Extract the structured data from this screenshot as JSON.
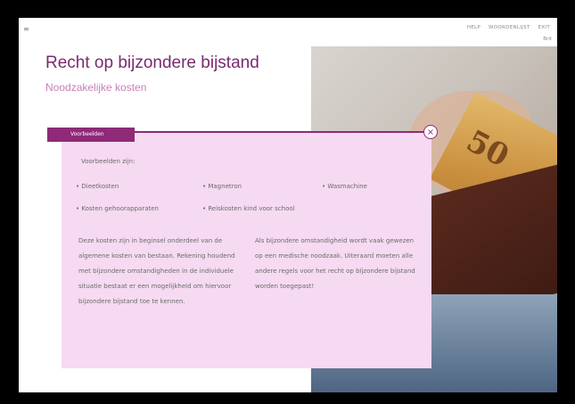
{
  "nav": {
    "help": "HELP",
    "glossary": "WOORDENLIJST",
    "exit": "EXIT"
  },
  "header": {
    "title": "Recht op bijzondere bijstand",
    "subtitle": "Noodzakelijke kosten"
  },
  "photo": {
    "tag": "Brit",
    "banknote_value": "50"
  },
  "panel": {
    "tab_label": "Voorbeelden",
    "close_symbol": "×",
    "intro": "Voorbeelden zijn:",
    "examples": [
      "• Dieetkosten",
      "• Magnetron",
      "• Wasmachine",
      "• Kosten gehoorapparaten",
      "• Reiskosten kind voor school"
    ],
    "paragraph_left": "Deze kosten zijn in beginsel onderdeel van de algemene kosten van bestaan. Rekening houdend met bijzondere omstandigheden in de individuele situatie bestaat er een mogelijkheid om hiervoor bijzondere bijstand toe te kennen.",
    "paragraph_right": "Als bijzondere omstandigheid wordt vaak gewezen op een medische noodzaak. Uiteraard moeten alle andere regels voor het recht op bijzondere bijstand worden toegepast!"
  }
}
